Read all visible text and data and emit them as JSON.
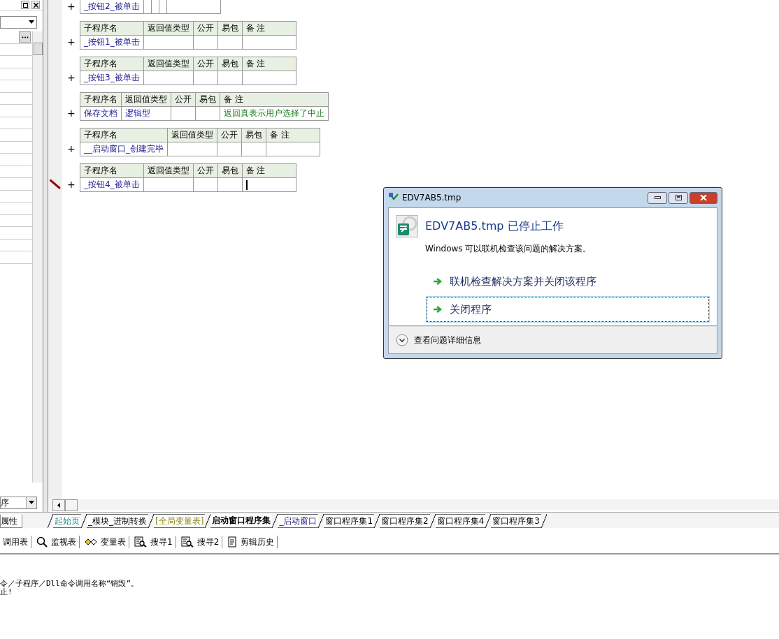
{
  "left_panel": {
    "combo": "序",
    "tab": "属性"
  },
  "tables": [
    {
      "rows": [
        {
          "marker": "+",
          "name": "_按钮2_被单击",
          "return_type": "",
          "public": "",
          "easy_pack": "",
          "note": "",
          "editing": false
        }
      ]
    },
    {
      "columns": [
        "子程序名",
        "返回值类型",
        "公开",
        "易包",
        "备 注"
      ],
      "rows": [
        {
          "marker": "+",
          "name": "_按钮1_被单击",
          "return_type": "",
          "public": "",
          "easy_pack": "",
          "note": "",
          "editing": false
        }
      ]
    },
    {
      "columns": [
        "子程序名",
        "返回值类型",
        "公开",
        "易包",
        "备 注"
      ],
      "rows": [
        {
          "marker": "+",
          "name": "_按钮3_被单击",
          "return_type": "",
          "public": "",
          "easy_pack": "",
          "note": "",
          "editing": false
        }
      ]
    },
    {
      "columns": [
        "子程序名",
        "返回值类型",
        "公开",
        "易包",
        "备 注"
      ],
      "rows": [
        {
          "marker": "+",
          "name": "保存文档",
          "return_type": "逻辑型",
          "public": "",
          "easy_pack": "",
          "note": "返回真表示用户选择了中止",
          "editing": false
        }
      ]
    },
    {
      "columns": [
        "子程序名",
        "返回值类型",
        "公开",
        "易包",
        "备 注"
      ],
      "rows": [
        {
          "marker": "+",
          "name": "__启动窗口_创建完毕",
          "return_type": "",
          "public": "",
          "easy_pack": "",
          "note": "",
          "editing": false
        }
      ]
    },
    {
      "columns": [
        "子程序名",
        "返回值类型",
        "公开",
        "易包",
        "备 注"
      ],
      "rows": [
        {
          "marker": "+",
          "name": "_按钮4_被单击",
          "return_type": "",
          "public": "",
          "easy_pack": "",
          "note": "",
          "editing": true
        }
      ]
    }
  ],
  "tabs": [
    {
      "label": "起始页",
      "selected": false,
      "kind": "start"
    },
    {
      "label": "_模块_进制转换",
      "selected": false,
      "kind": "module"
    },
    {
      "label": "[全局变量表]",
      "selected": false,
      "kind": "globals"
    },
    {
      "label": "启动窗口程序集",
      "selected": true,
      "kind": "class"
    },
    {
      "label": "_启动窗口",
      "selected": false,
      "kind": "form"
    },
    {
      "label": "窗口程序集1",
      "selected": false,
      "kind": "class"
    },
    {
      "label": "窗口程序集2",
      "selected": false,
      "kind": "class"
    },
    {
      "label": "窗口程序集4",
      "selected": false,
      "kind": "class"
    },
    {
      "label": "窗口程序集3",
      "selected": false,
      "kind": "class"
    }
  ],
  "toolbar": [
    {
      "kind": "none",
      "label": "调用表"
    },
    {
      "kind": "search",
      "label": "监视表"
    },
    {
      "kind": "glasses",
      "label": "变量表"
    },
    {
      "kind": "find",
      "label": "搜寻1"
    },
    {
      "kind": "find",
      "label": "搜寻2"
    },
    {
      "kind": "doc",
      "label": "剪辑历史"
    }
  ],
  "output": [
    "令／子程序／Dll命令调用名称“销毁”。",
    "止!"
  ],
  "dialog": {
    "title": "EDV7AB5.tmp",
    "heading": "EDV7AB5.tmp 已停止工作",
    "message": "Windows 可以联机检查该问题的解决方案。",
    "options": [
      {
        "label": "联机检查解决方案并关闭该程序",
        "selected": false
      },
      {
        "label": "关闭程序",
        "selected": true
      }
    ],
    "details": "查看问题详细信息"
  }
}
